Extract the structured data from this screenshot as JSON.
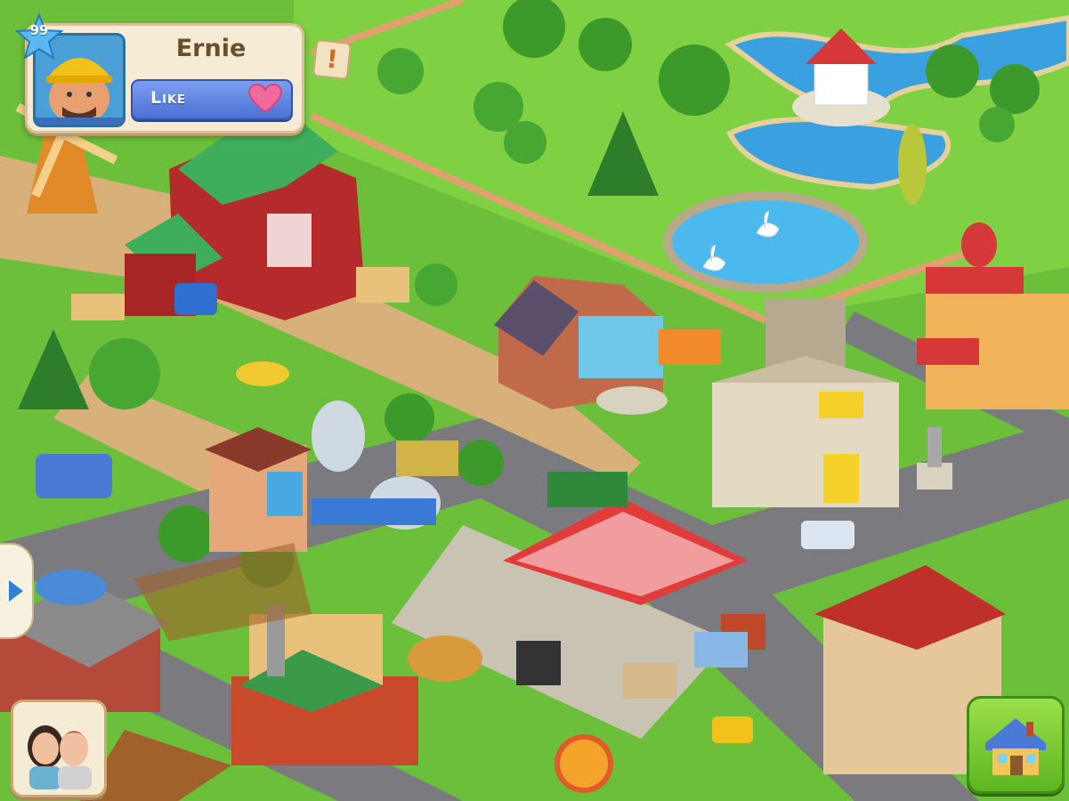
{
  "player": {
    "name": "Ernie",
    "level": "99",
    "like_label": "Like",
    "avatar_icon": "miner-avatar",
    "like_icon": "heart-icon"
  },
  "hud": {
    "alert_label": "!",
    "left_arrow_icon": "play-arrow-icon",
    "friends_icon": "friends-icon",
    "build_icon": "house-build-icon"
  },
  "colors": {
    "like_button": "#5b7fe0",
    "heart": "#f06a9c",
    "build_button": "#7ccc33",
    "card_bg": "#f6ecd6"
  }
}
